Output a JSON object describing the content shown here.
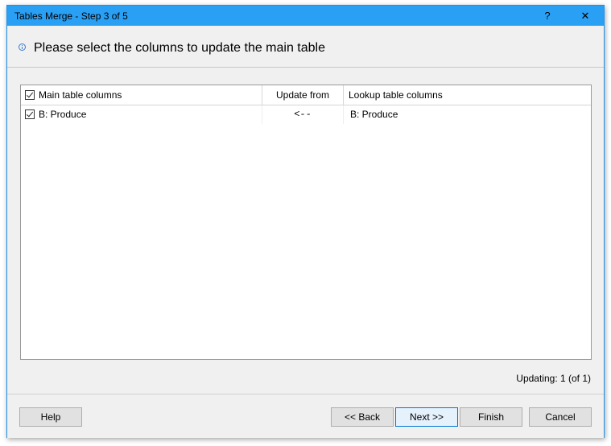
{
  "window": {
    "title": "Tables Merge - Step 3 of 5",
    "help_glyph": "?",
    "close_glyph": "✕"
  },
  "header": {
    "text": "Please select the columns to update the main table"
  },
  "grid": {
    "columns": [
      {
        "label": "Main table columns",
        "checked": true
      },
      {
        "label": "Update from"
      },
      {
        "label": "Lookup table columns"
      }
    ],
    "rows": [
      {
        "checked": true,
        "main": "B: Produce",
        "arrow": "<--",
        "lookup": "B: Produce"
      }
    ]
  },
  "status": {
    "text": "Updating: 1 (of 1)"
  },
  "buttons": {
    "help": "Help",
    "back": "<< Back",
    "next": "Next >>",
    "finish": "Finish",
    "cancel": "Cancel"
  },
  "colors": {
    "titlebar": "#2aa0f5",
    "window_bg": "#f0f0f0",
    "accent_border": "#0078d7"
  }
}
